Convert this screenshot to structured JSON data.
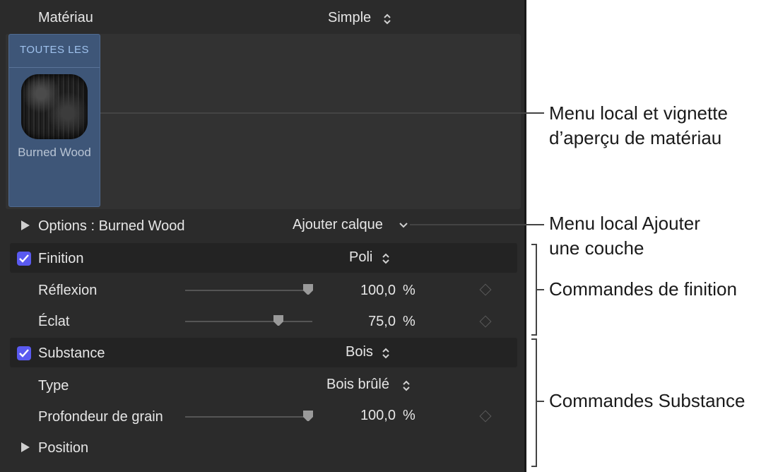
{
  "material": {
    "label": "Matériau",
    "value": "Simple"
  },
  "library": {
    "category": "TOUTES LES",
    "thumbnail_name": "Burned Wood"
  },
  "options": {
    "label": "Options : Burned Wood",
    "add_layer": "Ajouter calque"
  },
  "finish": {
    "label": "Finition",
    "value": "Poli",
    "reflection": {
      "label": "Réflexion",
      "value": "100,0",
      "unit": "%",
      "fraction": 1.0
    },
    "shine": {
      "label": "Éclat",
      "value": "75,0",
      "unit": "%",
      "fraction": 0.75
    }
  },
  "substance": {
    "label": "Substance",
    "value": "Bois",
    "type": {
      "label": "Type",
      "value": "Bois brûlé"
    },
    "grain": {
      "label": "Profondeur de grain",
      "value": "100,0",
      "unit": "%",
      "fraction": 1.0
    },
    "position_label": "Position"
  },
  "callouts": {
    "material_menu": [
      "Menu local et vignette",
      "d’aperçu de matériau"
    ],
    "add_layer_menu": [
      "Menu local Ajouter",
      "une couche"
    ],
    "finish_controls": "Commandes de finition",
    "substance_controls": "Commandes Substance"
  },
  "colors": {
    "panel": "#2b2b2b",
    "accent": "#5a5af0",
    "card": "#3e5678"
  }
}
